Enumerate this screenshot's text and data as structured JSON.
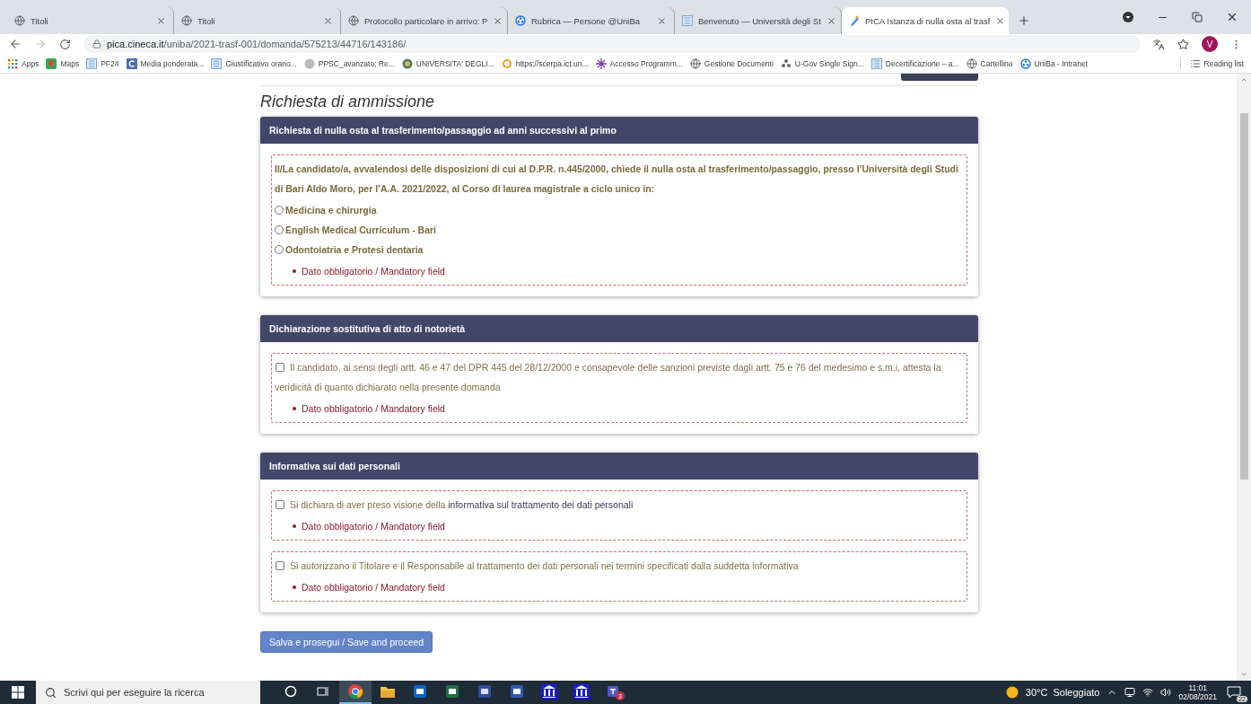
{
  "browser": {
    "tabs": [
      {
        "title": "Titoli",
        "selected": false
      },
      {
        "title": "Titoli",
        "selected": false
      },
      {
        "title": "Protocollo particolare in arrivo: P",
        "selected": false
      },
      {
        "title": "Rubrica — Persone @UniBa",
        "selected": false
      },
      {
        "title": "Benvenuto — Università degli St",
        "selected": false
      },
      {
        "title": "PICA Istanza di nulla osta al trasf",
        "selected": true
      }
    ],
    "profile": "V",
    "url_host": "pica.cineca.it",
    "url_path": "/uniba/2021-trasf-001/domanda/575213/44716/143186/",
    "bookmarks": [
      "Apps",
      "Maps",
      "PF24",
      "Media ponderata...",
      "Giustificativo orario...",
      "PPSC_avanzato: Re...",
      "UNIVERSITA' DEGLI...",
      "https://scerpa.ict.un...",
      "Accesso Programm...",
      "Gestione Documenti",
      "U-Gov Single Sign...",
      "Decertificazione – a...",
      "Cartellino",
      "UniBa - Intranet"
    ],
    "reading_list": "Reading list"
  },
  "page": {
    "heading": "Richiesta di ammissione",
    "sections": [
      {
        "title": "Richiesta di nulla osta al trasferimento/passaggio ad anni successivi al primo",
        "groups": [
          {
            "kind": "radio",
            "intro": "Il/La candidato/a, avvalendosi delle disposizioni di cui al D.P.R. n.445/2000, chiede il nulla osta al trasferimento/passaggio, presso l’Università degli Studi di Bari Aldo Moro, per l’A.A. 2021/2022, al Corso di laurea magistrale a ciclo unico in:",
            "options": [
              {
                "label": "Medicina e chirurgia",
                "selected": false
              },
              {
                "label": "English Medical Curriculum - Bari",
                "selected": false
              },
              {
                "label": "Odontoiatria e Protesi dentaria",
                "selected": false
              }
            ],
            "error": "Dato obbligatorio / Mandatory field"
          }
        ]
      },
      {
        "title": "Dichiarazione sostitutiva di atto di notorietà",
        "groups": [
          {
            "kind": "checkbox",
            "checked": false,
            "text": "Il candidato, ai sensi degli artt. 46 e 47 del DPR 445 del 28/12/2000 e consapevole delle sanzioni previste dagli artt. 75 e 76 del medesimo e s.m.i, attesta la veridicità di quanto dichiarato nella presente domanda",
            "error": "Dato obbligatorio / Mandatory field"
          }
        ]
      },
      {
        "title": "Informativa sui dati personali",
        "groups": [
          {
            "kind": "checkbox",
            "checked": false,
            "text": "Si dichiara di aver preso visione della ",
            "link": "informativa sul trattamento dei dati personali",
            "error": "Dato obbligatorio / Mandatory field"
          },
          {
            "kind": "checkbox",
            "checked": false,
            "text": "Si autorizzano il Titolare e il Responsabile al trattamento dei dati personali nei termini specificati dalla suddetta informativa",
            "error": "Dato obbligatorio / Mandatory field"
          }
        ]
      }
    ],
    "submit": "Salva e prosegui / Save and proceed"
  },
  "taskbar": {
    "search_placeholder": "Scrivi qui per eseguire la ricerca",
    "apps": [
      {
        "selected": false
      },
      {
        "selected": false
      },
      {
        "selected": true
      },
      {
        "selected": false
      },
      {
        "selected": false
      },
      {
        "selected": false
      },
      {
        "selected": false
      },
      {
        "selected": false
      },
      {
        "selected": false
      },
      {
        "selected": false
      },
      {
        "selected": false,
        "badge": "3"
      }
    ],
    "weather": "30°C  Soleggiato",
    "time": "11:01",
    "date": "02/08/2021",
    "notifications": "22"
  }
}
